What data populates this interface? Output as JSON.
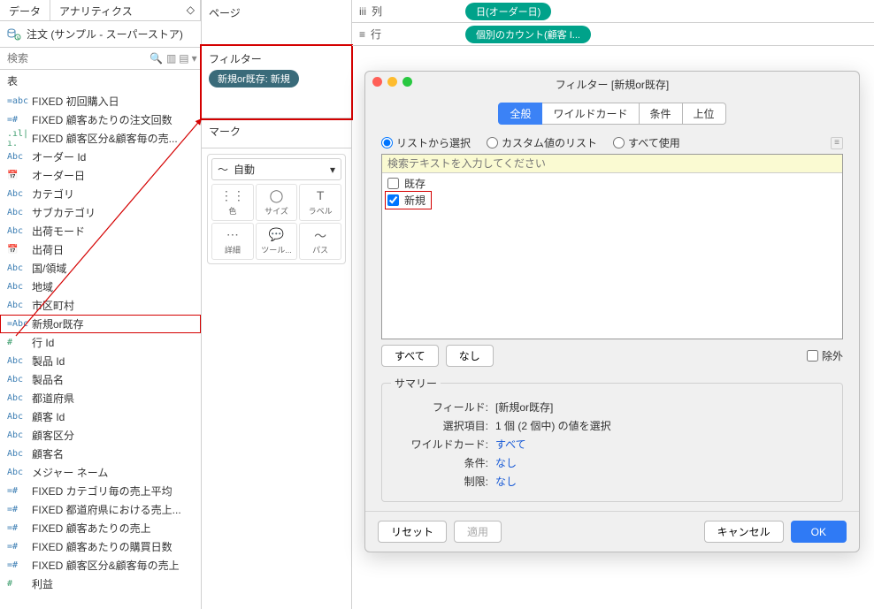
{
  "sidebar": {
    "tabs": {
      "data": "データ",
      "analytics": "アナリティクス"
    },
    "datasource": "注文 (サンプル - スーパーストア)",
    "search_placeholder": "検索",
    "table_label": "表",
    "fields": [
      {
        "icon": "=abc",
        "cls": "ic-eq",
        "label": "FIXED 初回購入日"
      },
      {
        "icon": "=#",
        "cls": "ic-eq",
        "label": "FIXED 顧客あたりの注文回数"
      },
      {
        "icon": ".ıl|ı.",
        "cls": "ic-num",
        "label": "FIXED 顧客区分&顧客毎の売..."
      },
      {
        "icon": "Abc",
        "cls": "ic-abc",
        "label": "オーダー Id"
      },
      {
        "icon": "📅",
        "cls": "ic-date",
        "label": "オーダー日"
      },
      {
        "icon": "Abc",
        "cls": "ic-abc",
        "label": "カテゴリ"
      },
      {
        "icon": "Abc",
        "cls": "ic-abc",
        "label": "サブカテゴリ"
      },
      {
        "icon": "Abc",
        "cls": "ic-abc",
        "label": "出荷モード"
      },
      {
        "icon": "📅",
        "cls": "ic-date",
        "label": "出荷日"
      },
      {
        "icon": "Abc",
        "cls": "ic-abc",
        "label": "国/領域"
      },
      {
        "icon": "Abc",
        "cls": "ic-abc",
        "label": "地域"
      },
      {
        "icon": "Abc",
        "cls": "ic-abc",
        "label": "市区町村"
      },
      {
        "icon": "=Abc",
        "cls": "ic-eq",
        "label": "新規or既存",
        "boxed": true
      },
      {
        "icon": "#",
        "cls": "ic-num",
        "label": "行 Id"
      },
      {
        "icon": "Abc",
        "cls": "ic-abc",
        "label": "製品 Id"
      },
      {
        "icon": "Abc",
        "cls": "ic-abc",
        "label": "製品名"
      },
      {
        "icon": "Abc",
        "cls": "ic-abc",
        "label": "都道府県"
      },
      {
        "icon": "Abc",
        "cls": "ic-abc",
        "label": "顧客 Id"
      },
      {
        "icon": "Abc",
        "cls": "ic-abc",
        "label": "顧客区分"
      },
      {
        "icon": "Abc",
        "cls": "ic-abc",
        "label": "顧客名"
      },
      {
        "icon": "Abc",
        "cls": "ic-abc",
        "label": "メジャー ネーム"
      },
      {
        "icon": "=#",
        "cls": "ic-eq",
        "label": "FIXED カテゴリ毎の売上平均"
      },
      {
        "icon": "=#",
        "cls": "ic-eq",
        "label": "FIXED 都道府県における売上..."
      },
      {
        "icon": "=#",
        "cls": "ic-eq",
        "label": "FIXED 顧客あたりの売上"
      },
      {
        "icon": "=#",
        "cls": "ic-eq",
        "label": "FIXED 顧客あたりの購買日数"
      },
      {
        "icon": "=#",
        "cls": "ic-eq",
        "label": "FIXED 顧客区分&顧客毎の売上"
      },
      {
        "icon": "#",
        "cls": "ic-num",
        "label": "利益"
      }
    ]
  },
  "mid": {
    "pages": "ページ",
    "filters": "フィルター",
    "filter_pill": "新規or既存: 新規",
    "marks": "マーク",
    "mark_type": "自動",
    "cells": [
      {
        "icon": "⋮⋮",
        "label": "色"
      },
      {
        "icon": "◯",
        "label": "サイズ"
      },
      {
        "icon": "T",
        "label": "ラベル"
      },
      {
        "icon": "⋯",
        "label": "詳細"
      },
      {
        "icon": "💬",
        "label": "ツール..."
      },
      {
        "icon": "〜",
        "label": "パス"
      }
    ]
  },
  "shelves": {
    "columns_label": "列",
    "columns_pill": "日(オーダー日)",
    "rows_label": "行",
    "rows_pill": "個別のカウント(顧客 I..."
  },
  "dialog": {
    "title": "フィルター [新規or既存]",
    "tabs": {
      "general": "全般",
      "wildcard": "ワイルドカード",
      "condition": "条件",
      "top": "上位"
    },
    "radios": {
      "list": "リストから選択",
      "custom": "カスタム値のリスト",
      "all": "すべて使用"
    },
    "search_placeholder": "検索テキストを入力してください",
    "items": [
      {
        "label": "既存",
        "checked": false,
        "boxed": false
      },
      {
        "label": "新規",
        "checked": true,
        "boxed": true
      }
    ],
    "btn_all": "すべて",
    "btn_none": "なし",
    "exclude": "除外",
    "summary": {
      "title": "サマリー",
      "field_k": "フィールド:",
      "field_v": "[新規or既存]",
      "sel_k": "選択項目:",
      "sel_v": "1 個 (2 個中) の値を選択",
      "wc_k": "ワイルドカード:",
      "wc_v": "すべて",
      "cond_k": "条件:",
      "cond_v": "なし",
      "limit_k": "制限:",
      "limit_v": "なし"
    },
    "footer": {
      "reset": "リセット",
      "apply": "適用",
      "cancel": "キャンセル",
      "ok": "OK"
    }
  }
}
